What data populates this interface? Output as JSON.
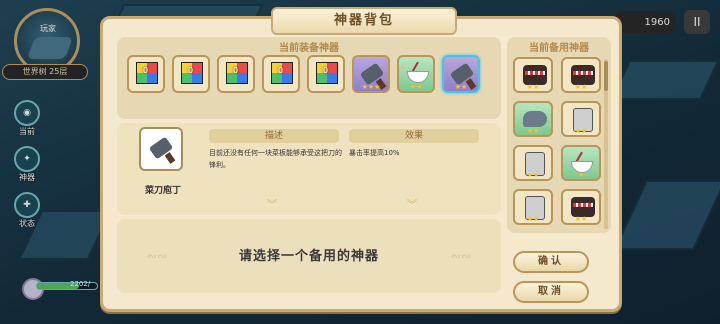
{
  "hud": {
    "badge_title": "玩家",
    "world_level": "世界树 25层",
    "side_buttons": [
      {
        "label": "当前",
        "icon": "map-icon"
      },
      {
        "label": "神器",
        "icon": "artifact-icon"
      },
      {
        "label": "状态",
        "icon": "status-icon"
      }
    ],
    "hp_text": "2202/",
    "hp_fraction": 0.7,
    "coins": "1960",
    "pause_glyph": "II"
  },
  "dialog": {
    "title": "神器背包",
    "equipped_header": "当前装备神器",
    "spare_header": "当前备用神器",
    "equipped": [
      {
        "kind": "mosaic",
        "num": "0",
        "stars": ""
      },
      {
        "kind": "mosaic",
        "num": "0",
        "stars": ""
      },
      {
        "kind": "mosaic",
        "num": "0",
        "stars": ""
      },
      {
        "kind": "mosaic",
        "num": "0",
        "stars": ""
      },
      {
        "kind": "mosaic",
        "num": "0",
        "stars": ""
      },
      {
        "kind": "cleaver",
        "num": "",
        "stars": "★★★"
      },
      {
        "kind": "bowl",
        "num": "",
        "stars": "★★"
      },
      {
        "kind": "cleaver",
        "num": "",
        "stars": "★★"
      }
    ],
    "selected_item": {
      "name": "菜刀庖丁",
      "desc_header": "描述",
      "desc": "目前还没有任何一块菜板能够承受这把刀的锋利。",
      "effect_header": "效果",
      "effect": "暴击率提高10%"
    },
    "prompt": "请选择一个备用的神器",
    "spare": [
      {
        "kind": "monster",
        "stars": "★★"
      },
      {
        "kind": "monster",
        "stars": "★★"
      },
      {
        "kind": "bird",
        "stars": "★★"
      },
      {
        "kind": "phone",
        "stars": "★★"
      },
      {
        "kind": "phone",
        "stars": "★★"
      },
      {
        "kind": "bowl",
        "stars": "★"
      },
      {
        "kind": "phone",
        "stars": "★★"
      },
      {
        "kind": "monster",
        "stars": "★★"
      }
    ],
    "confirm_label": "确认",
    "cancel_label": "取消"
  }
}
